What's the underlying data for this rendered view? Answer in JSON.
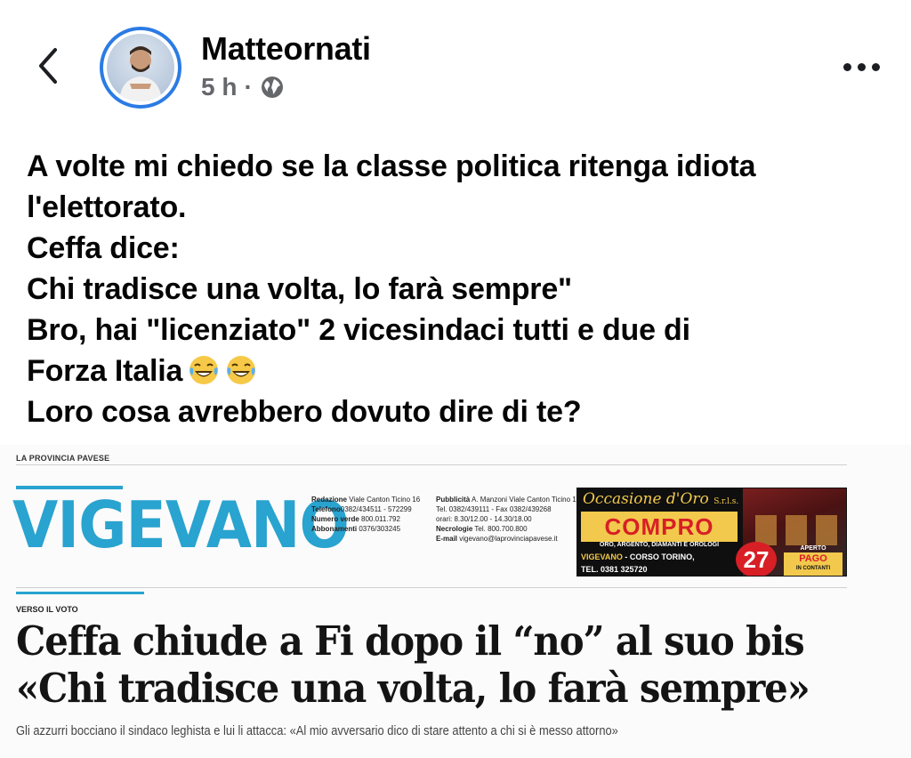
{
  "post": {
    "author": "Matteornati",
    "time": "5 h",
    "separator": "·",
    "privacy_icon": "globe-icon",
    "lines": [
      "A volte mi chiedo se la classe politica ritenga idiota",
      "l'elettorato.",
      "Ceffa dice:",
      "Chi tradisce una volta, lo farà sempre\"",
      "Bro, hai \"licenziato\" 2 vicesindaci tutti e due di",
      "Forza Italia",
      "Loro cosa avrebbero dovuto dire di te?"
    ],
    "emoji": [
      "joy-emoji",
      "joy-emoji"
    ]
  },
  "clipping": {
    "masthead": "LA PROVINCIA PAVESE",
    "section": "VIGEVANO",
    "contact_left": [
      {
        "label": "Redazione",
        "text": " Viale Canton Ticino 16"
      },
      {
        "label": "Telefono",
        "text": "0382/434511 - 572299"
      },
      {
        "label": "Numero verde",
        "text": " 800.011.792"
      },
      {
        "label": "Abbonamenti",
        "text": " 0376/303245"
      }
    ],
    "contact_right": [
      {
        "label": "Pubblicità",
        "text": " A. Manzoni Viale Canton Ticino 16"
      },
      {
        "label": "",
        "text": "Tel. 0382/439111 - Fax 0382/439268"
      },
      {
        "label": "",
        "text": "orari: 8.30/12.00 - 14.30/18.00"
      },
      {
        "label": "Necrologie",
        "text": " Tel. 800.700.800"
      },
      {
        "label": "E-mail",
        "text": " vigevano@laprovinciapavese.it"
      }
    ],
    "ad": {
      "script": "Occasione d'Oro",
      "script_suffix": "S.r.l.s.",
      "compro": "COMPRO",
      "sub": "ORO, ARGENTO, DIAMANTI E OROLOGI",
      "city": "VIGEVANO",
      "address": " - CORSO TORINO,",
      "number": "27",
      "phone": "TEL. 0381 325720",
      "open": "APERTO",
      "pago": "PAGO",
      "cash": "IN CONTANTI"
    },
    "kicker": "VERSO IL VOTO",
    "headline_1": "Ceffa chiude a Fi dopo il “no” al suo bis",
    "headline_2": "«Chi tradisce una volta, lo farà sempre»",
    "subheadline": "Gli azzurri bocciano il sindaco leghista e lui li attacca: «Al mio avversario dico di stare attento a chi si è messo attorno»",
    "colors": {
      "section_blue": "#29a3cf",
      "ad_gold": "#f2c94c",
      "ad_red": "#d81f26"
    }
  },
  "colors": {
    "avatar_ring": "#2b7be4",
    "meta_gray": "#65676b"
  }
}
